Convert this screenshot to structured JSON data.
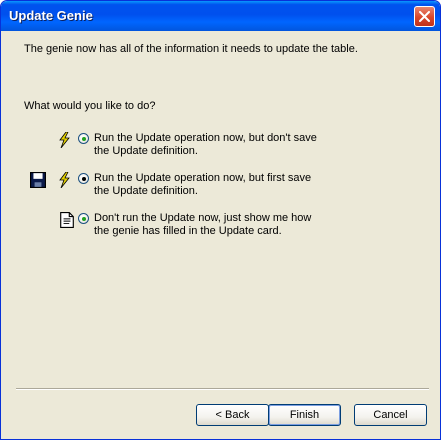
{
  "window": {
    "title": "Update Genie"
  },
  "intro_text": "The genie now has all of the information it needs to update the table.",
  "question": "What would you like to do?",
  "options": [
    {
      "line1": "Run the Update operation now, but don't save",
      "line2": "the Update definition.",
      "icons": [
        "lightning-icon"
      ],
      "selected": false
    },
    {
      "line1": "Run the Update operation now, but first save",
      "line2": "the Update definition.",
      "icons": [
        "floppy-disk-icon",
        "lightning-icon"
      ],
      "selected": true
    },
    {
      "line1": "Don't run the Update now, just show me how",
      "line2": "the genie has filled in the Update card.",
      "icons": [
        "document-icon"
      ],
      "selected": false
    }
  ],
  "buttons": {
    "back": "< Back",
    "finish": "Finish",
    "cancel": "Cancel"
  },
  "colors": {
    "titlebar": "#0053ee",
    "dialog_bg": "#ece9d8",
    "lightning": "#e6d200"
  }
}
